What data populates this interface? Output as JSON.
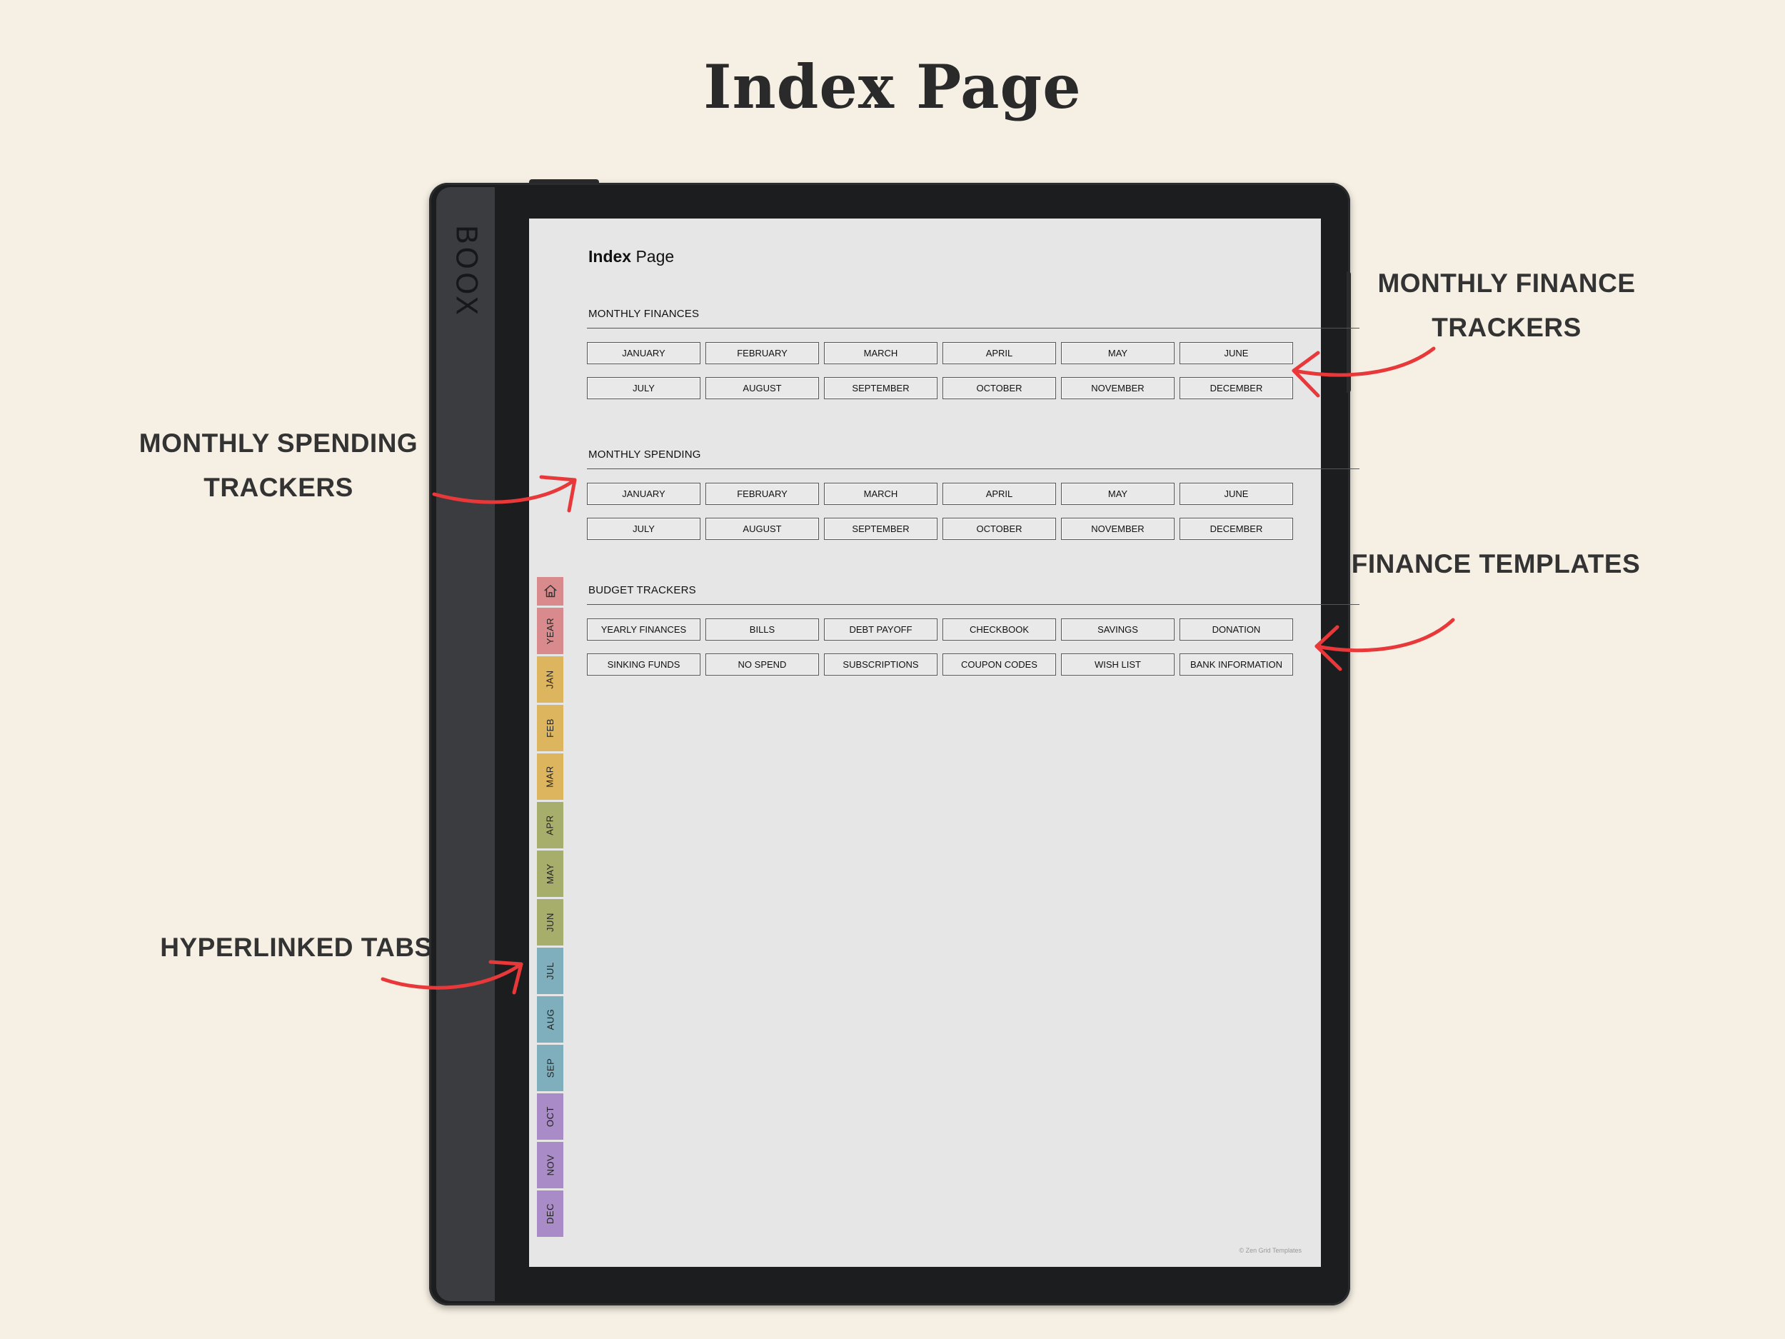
{
  "title": "Index Page",
  "callouts": {
    "monthly_finance": [
      "MONTHLY FINANCE",
      "TRACKERS"
    ],
    "monthly_spending": [
      "MONTHLY SPENDING",
      "TRACKERS"
    ],
    "finance_templates": [
      "FINANCE TEMPLATES"
    ],
    "hyperlinked_tabs": [
      "HYPERLINKED TABS"
    ]
  },
  "device": {
    "brand": "BOOX"
  },
  "screen": {
    "heading_bold": "Index",
    "heading_rest": " Page",
    "sections": [
      {
        "label": "MONTHLY FINANCES",
        "buttons": [
          "JANUARY",
          "FEBRUARY",
          "MARCH",
          "APRIL",
          "MAY",
          "JUNE",
          "JULY",
          "AUGUST",
          "SEPTEMBER",
          "OCTOBER",
          "NOVEMBER",
          "DECEMBER"
        ]
      },
      {
        "label": "MONTHLY SPENDING",
        "buttons": [
          "JANUARY",
          "FEBRUARY",
          "MARCH",
          "APRIL",
          "MAY",
          "JUNE",
          "JULY",
          "AUGUST",
          "SEPTEMBER",
          "OCTOBER",
          "NOVEMBER",
          "DECEMBER"
        ]
      },
      {
        "label": "BUDGET TRACKERS",
        "buttons": [
          "YEARLY FINANCES",
          "BILLS",
          "DEBT PAYOFF",
          "CHECKBOOK",
          "SAVINGS",
          "DONATION",
          "SINKING FUNDS",
          "NO SPEND",
          "SUBSCRIPTIONS",
          "COUPON CODES",
          "WISH LIST",
          "BANK INFORMATION"
        ]
      }
    ],
    "copyright": "© Zen Grid Templates"
  },
  "tabs": [
    {
      "icon": "home-icon",
      "color": "#d98a8c"
    },
    {
      "label": "YEAR",
      "color": "#d98a8c"
    },
    {
      "label": "JAN",
      "color": "#dcb55e"
    },
    {
      "label": "FEB",
      "color": "#dcb55e"
    },
    {
      "label": "MAR",
      "color": "#dcb55e"
    },
    {
      "label": "APR",
      "color": "#a7ad6a"
    },
    {
      "label": "MAY",
      "color": "#a7ad6a"
    },
    {
      "label": "JUN",
      "color": "#a7ad6a"
    },
    {
      "label": "JUL",
      "color": "#7fafbc"
    },
    {
      "label": "AUG",
      "color": "#7fafbc"
    },
    {
      "label": "SEP",
      "color": "#7fafbc"
    },
    {
      "label": "OCT",
      "color": "#a98bc7"
    },
    {
      "label": "NOV",
      "color": "#a98bc7"
    },
    {
      "label": "DEC",
      "color": "#a98bc7"
    }
  ],
  "colors": {
    "arrow": "#e8383a",
    "background": "#f6f0e4",
    "screen": "#e6e6e6"
  }
}
